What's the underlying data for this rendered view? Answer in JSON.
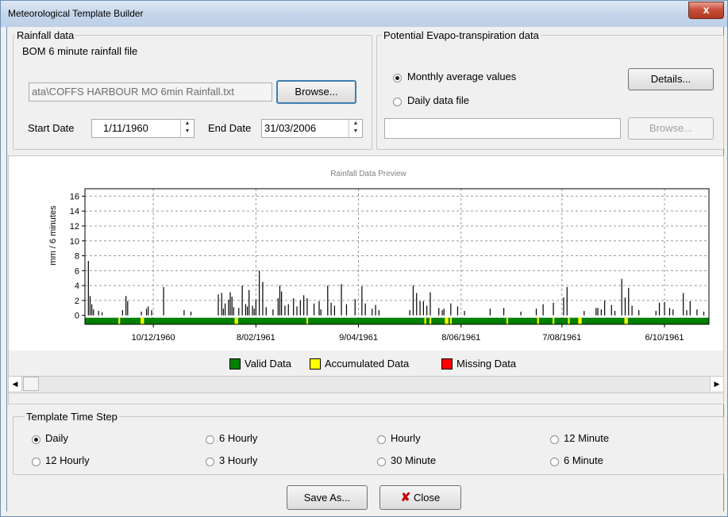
{
  "window": {
    "title": "Meteorological Template Builder",
    "close_symbol": "x"
  },
  "rainfall": {
    "group_label": "Rainfall data",
    "file_label": "BOM 6 minute rainfall file",
    "file_path": "ata\\COFFS HARBOUR MO 6min Rainfall.txt",
    "browse_label": "Browse...",
    "start_date_label": "Start Date",
    "start_date": "1/11/1960",
    "end_date_label": "End Date",
    "end_date": "31/03/2006"
  },
  "pet": {
    "group_label": "Potential Evapo-transpiration data",
    "monthly_label": "Monthly average values",
    "daily_label": "Daily data file",
    "selected": "monthly",
    "details_label": "Details...",
    "daily_file_value": "",
    "browse_label": "Browse..."
  },
  "chart_data": {
    "type": "bar",
    "title": "Rainfall Data Preview",
    "xlabel": "",
    "ylabel": "mm / 6 minutes",
    "x_tick_labels": [
      "10/12/1960",
      "8/02/1961",
      "9/04/1961",
      "8/06/1961",
      "7/08/1961",
      "6/10/1961"
    ],
    "y_ticks": [
      0,
      2,
      4,
      6,
      8,
      10,
      12,
      14,
      16
    ],
    "ylim": [
      -1.2,
      17
    ],
    "grid": true,
    "x_days_range": [
      0,
      365
    ],
    "x_tick_days": [
      40,
      100,
      160,
      220,
      279,
      339
    ],
    "rainfall_days": [
      2,
      3,
      4,
      5,
      8,
      10,
      22,
      24,
      25,
      33,
      36,
      37,
      39,
      46,
      58,
      62,
      78,
      80,
      81,
      82,
      84,
      85,
      86,
      87,
      90,
      92,
      94,
      95,
      96,
      98,
      99,
      100,
      102,
      104,
      106,
      110,
      113,
      114,
      115,
      117,
      119,
      122,
      124,
      126,
      128,
      130,
      134,
      137,
      138,
      142,
      144,
      146,
      150,
      153,
      158,
      162,
      164,
      168,
      170,
      172,
      190,
      192,
      194,
      196,
      198,
      200,
      202,
      207,
      209,
      210,
      214,
      218,
      222,
      237,
      245,
      255,
      264,
      268,
      274,
      280,
      282,
      292,
      299,
      300,
      302,
      304,
      308,
      310,
      314,
      316,
      318,
      320,
      324,
      334,
      336,
      339,
      342,
      344,
      350,
      352,
      354,
      358,
      362
    ],
    "rainfall_values": [
      7.3,
      2.6,
      1.5,
      0.8,
      0.6,
      0.4,
      0.7,
      2.6,
      1.9,
      0.5,
      0.9,
      1.2,
      0.7,
      3.8,
      0.7,
      0.5,
      2.8,
      3.0,
      0.9,
      1.6,
      2.1,
      3.1,
      2.5,
      1.1,
      1.0,
      4.0,
      1.5,
      1.2,
      3.4,
      1.3,
      0.9,
      2.1,
      6.0,
      4.5,
      1.1,
      0.8,
      2.3,
      4.0,
      3.2,
      1.3,
      1.5,
      2.3,
      1.2,
      2.0,
      2.7,
      2.3,
      1.6,
      1.9,
      0.8,
      4.0,
      1.7,
      1.3,
      4.2,
      1.5,
      2.2,
      3.9,
      1.6,
      0.9,
      1.4,
      0.7,
      0.7,
      4.0,
      3.0,
      1.9,
      1.9,
      1.3,
      3.1,
      1.0,
      0.7,
      0.9,
      1.6,
      1.2,
      0.6,
      0.9,
      1.0,
      0.5,
      0.9,
      1.5,
      1.7,
      2.4,
      3.8,
      0.6,
      1.0,
      1.0,
      0.8,
      2.0,
      1.4,
      0.6,
      4.9,
      2.4,
      3.7,
      1.3,
      0.7,
      0.6,
      1.7,
      1.8,
      1.0,
      0.8,
      3.0,
      0.7,
      1.9,
      0.8,
      0.5
    ],
    "accumulated_days": [
      20,
      33,
      34,
      88,
      89,
      130,
      199,
      202,
      211,
      212,
      214,
      247,
      265,
      274,
      283,
      289,
      290,
      316,
      317
    ],
    "missing_days": [],
    "colors": {
      "valid": "#008000",
      "accumulated": "#ffff00",
      "missing": "#ff0000",
      "bars": "#000000"
    }
  },
  "legend": {
    "valid": "Valid Data",
    "accumulated": "Accumulated Data",
    "missing": "Missing Data"
  },
  "timestep": {
    "group_label": "Template Time Step",
    "options": [
      "Daily",
      "6 Hourly",
      "Hourly",
      "12 Minute",
      "12 Hourly",
      "3 Hourly",
      "30 Minute",
      "6 Minute"
    ],
    "selected": "Daily"
  },
  "buttons": {
    "save_as": "Save As...",
    "close": "Close"
  }
}
